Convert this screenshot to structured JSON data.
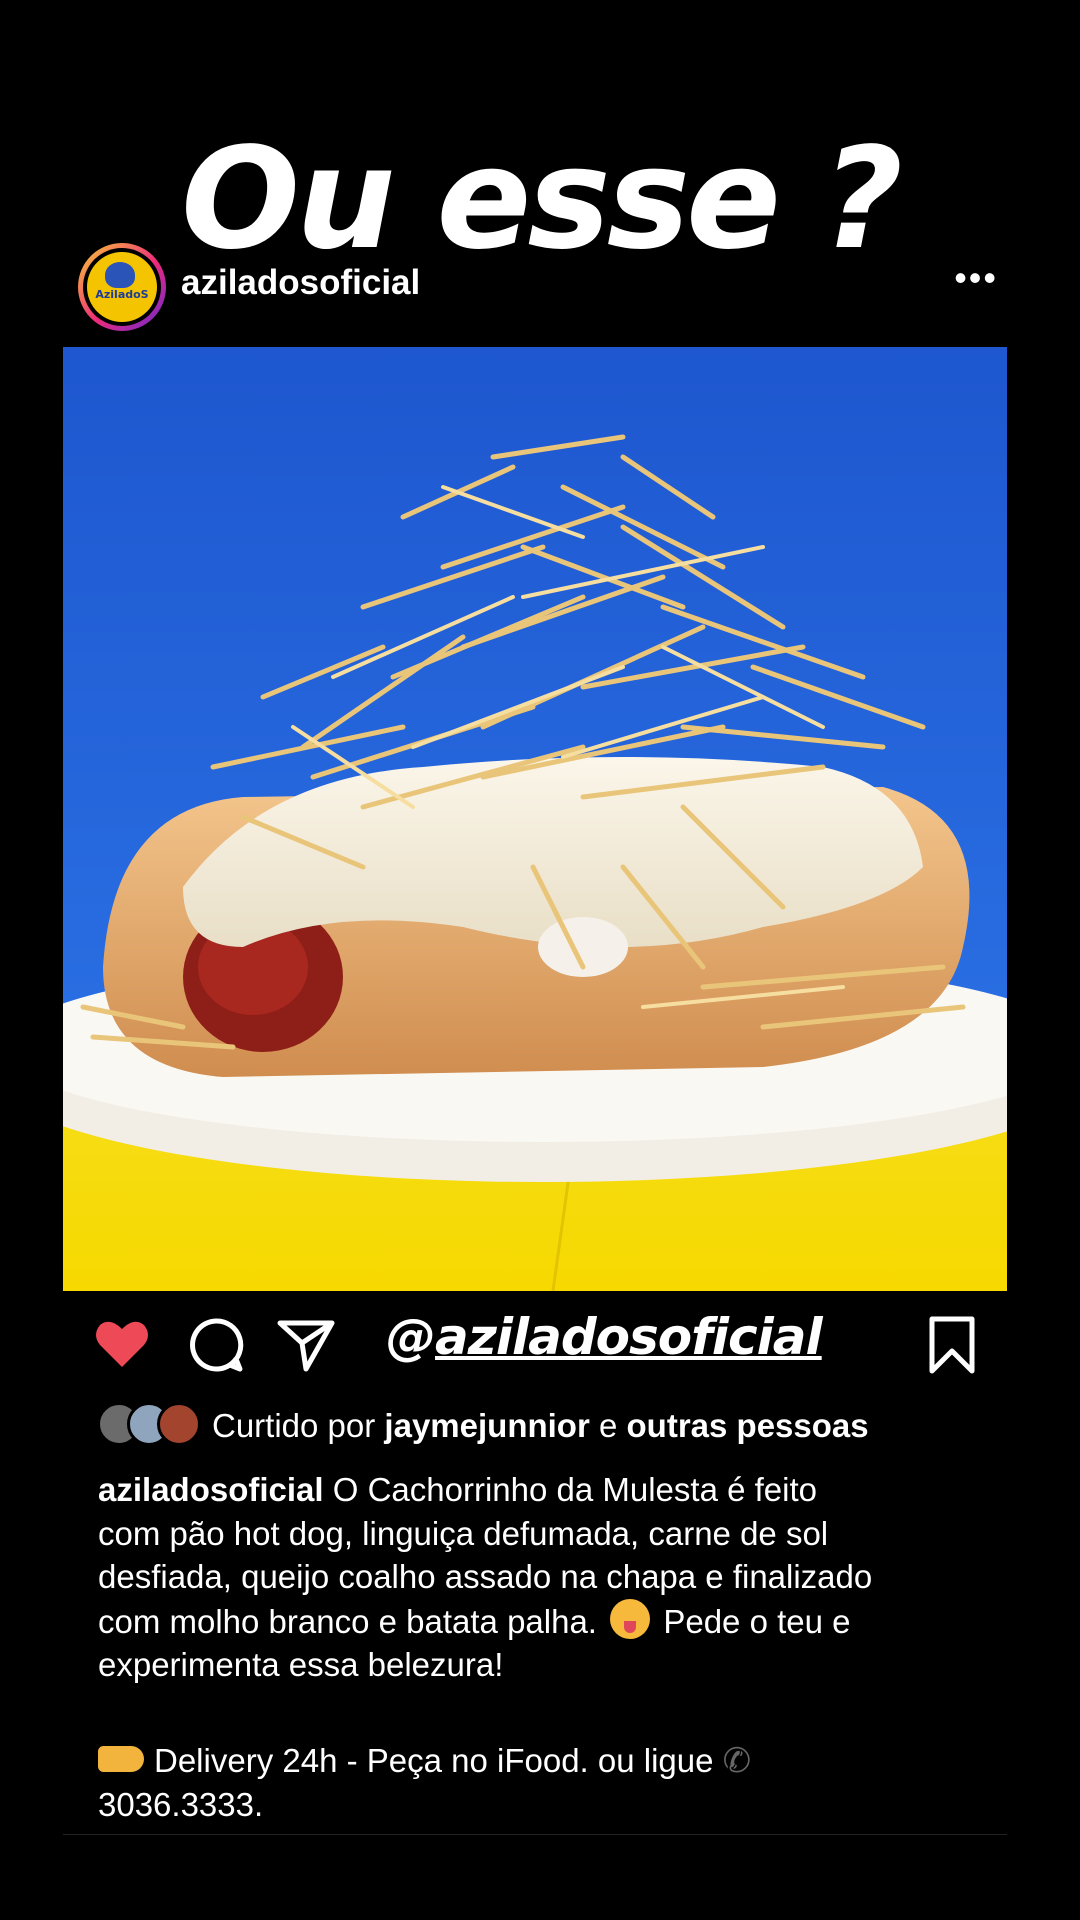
{
  "story": {
    "title": "Ou esse ?"
  },
  "post": {
    "username": "aziladosoficial",
    "avatar_logo_text": "AziladoS",
    "more_icon": "more-dots-icon",
    "image_description_icon": "hot-dog-photo"
  },
  "actions": {
    "like_icon": "heart-filled-icon",
    "comment_icon": "comment-icon",
    "share_icon": "send-icon",
    "save_icon": "bookmark-icon",
    "like_color": "#ed4956"
  },
  "mention_sticker": {
    "at": "@",
    "handle": "aziladosoficial"
  },
  "likes": {
    "prefix": "Curtido por ",
    "user": "jaymejunnior",
    "connector": " e ",
    "others": "outras pessoas"
  },
  "caption": {
    "user": "aziladosoficial",
    "line1": " O Cachorrinho da Mulesta é feito",
    "line2": "com pão hot dog, linguiça defumada, carne de sol",
    "line3": "desfiada, queijo coalho assado na chapa e finalizado",
    "line4a": "com molho branco e batata palha.",
    "line4b": " Pede o teu e",
    "line5": "experimenta essa belezura!",
    "line6": "Delivery 24h - Peça no iFood. ou ligue ",
    "line7": "3036.3333."
  }
}
